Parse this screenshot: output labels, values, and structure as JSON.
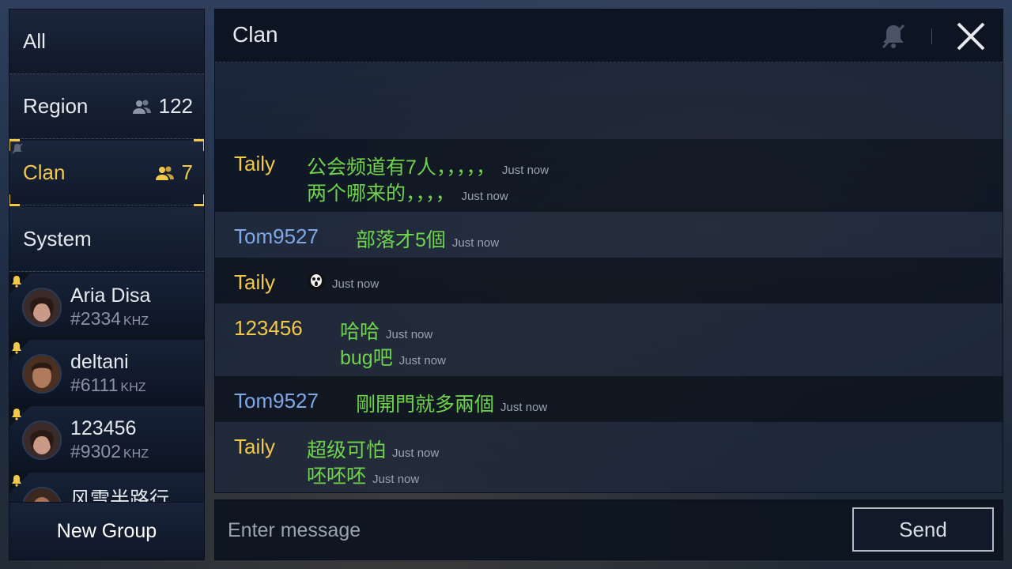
{
  "sidebar": {
    "channels": [
      {
        "label": "All",
        "count": ""
      },
      {
        "label": "Region",
        "count": "122"
      },
      {
        "label": "Clan",
        "count": "7"
      },
      {
        "label": "System",
        "count": ""
      }
    ],
    "contacts": [
      {
        "name": "Aria Disa",
        "tag": "#2334",
        "unit": "KHZ"
      },
      {
        "name": "deltani",
        "tag": "#6111",
        "unit": "KHZ"
      },
      {
        "name": "123456",
        "tag": "#9302",
        "unit": "KHZ"
      },
      {
        "name": "风雪半路行",
        "tag": "",
        "unit": ""
      }
    ],
    "new_group_label": "New Group"
  },
  "chat": {
    "title": "Clan",
    "messages": [
      {
        "sender": "Taily",
        "lines": [
          {
            "text": "公会频道有7人，，，，，",
            "time": "Just now"
          },
          {
            "text": "两个哪来的，，，，",
            "time": "Just now"
          }
        ]
      },
      {
        "sender": "Tom9527",
        "lines": [
          {
            "text": "部落才5個",
            "time": "Just now"
          }
        ]
      },
      {
        "sender": "Taily",
        "lines": [
          {
            "text": "",
            "emoji": "skull-emoji-icon",
            "time": "Just now"
          }
        ]
      },
      {
        "sender": "123456",
        "lines": [
          {
            "text": "哈哈",
            "time": "Just now"
          },
          {
            "text": "bug吧",
            "time": "Just now"
          }
        ]
      },
      {
        "sender": "Tom9527",
        "lines": [
          {
            "text": "剛開門就多兩個",
            "time": "Just now"
          }
        ]
      },
      {
        "sender": "Taily",
        "lines": [
          {
            "text": "超级可怕",
            "time": "Just now"
          },
          {
            "text": "呸呸呸",
            "time": "Just now"
          }
        ]
      }
    ]
  },
  "input": {
    "placeholder": "Enter message",
    "value": ""
  },
  "send_label": "Send",
  "colors": {
    "accent": "#f3c94a",
    "message_text": "#6fd44c",
    "sender_blue": "#7ea8e6",
    "sender_gold": "#f3c94a"
  }
}
